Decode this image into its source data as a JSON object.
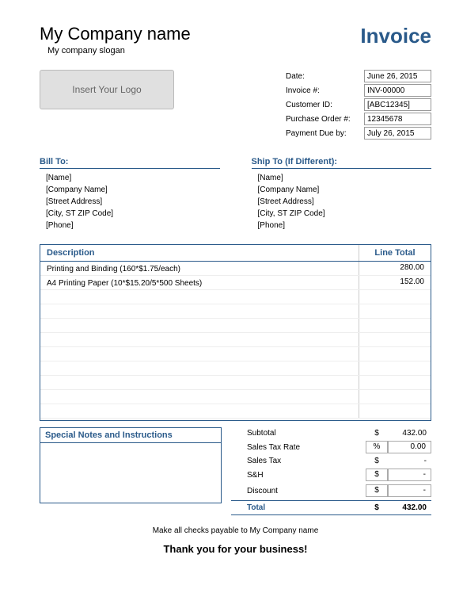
{
  "header": {
    "company_name": "My Company name",
    "company_slogan": "My company slogan",
    "invoice_title": "Invoice",
    "logo_placeholder": "Insert Your Logo"
  },
  "meta": {
    "labels": {
      "date": "Date:",
      "invoice_no": "Invoice #:",
      "customer_id": "Customer ID:",
      "po": "Purchase Order #:",
      "due": "Payment Due by:"
    },
    "values": {
      "date": "June 26, 2015",
      "invoice_no": "INV-00000",
      "customer_id": "[ABC12345]",
      "po": "12345678",
      "due": "July 26, 2015"
    }
  },
  "bill_to": {
    "title": "Bill To:",
    "name": "[Name]",
    "company": "[Company Name]",
    "street": "[Street Address]",
    "city": "[City, ST ZIP Code]",
    "phone": "[Phone]"
  },
  "ship_to": {
    "title": "Ship To (If Different):",
    "name": "[Name]",
    "company": "[Company Name]",
    "street": "[Street Address]",
    "city": "[City, ST ZIP Code]",
    "phone": "[Phone]"
  },
  "items": {
    "header_desc": "Description",
    "header_total": "Line Total",
    "rows": [
      {
        "desc": "Printing and Binding (160*$1.75/each)",
        "total": "280.00"
      },
      {
        "desc": "A4 Printing Paper (10*$15.20/5*500 Sheets)",
        "total": "152.00"
      }
    ]
  },
  "notes": {
    "title": "Special Notes and Instructions"
  },
  "totals": {
    "subtotal_label": "Subtotal",
    "subtotal_sym": "$",
    "subtotal_val": "432.00",
    "taxrate_label": "Sales Tax Rate",
    "taxrate_sym": "%",
    "taxrate_val": "0.00",
    "tax_label": "Sales Tax",
    "tax_sym": "$",
    "tax_val": "-",
    "sh_label": "S&H",
    "sh_sym": "$",
    "sh_val": "-",
    "discount_label": "Discount",
    "discount_sym": "$",
    "discount_val": "-",
    "total_label": "Total",
    "total_sym": "$",
    "total_val": "432.00"
  },
  "footer": {
    "payable": "Make all checks payable to My Company name",
    "thankyou": "Thank you for your business!"
  }
}
